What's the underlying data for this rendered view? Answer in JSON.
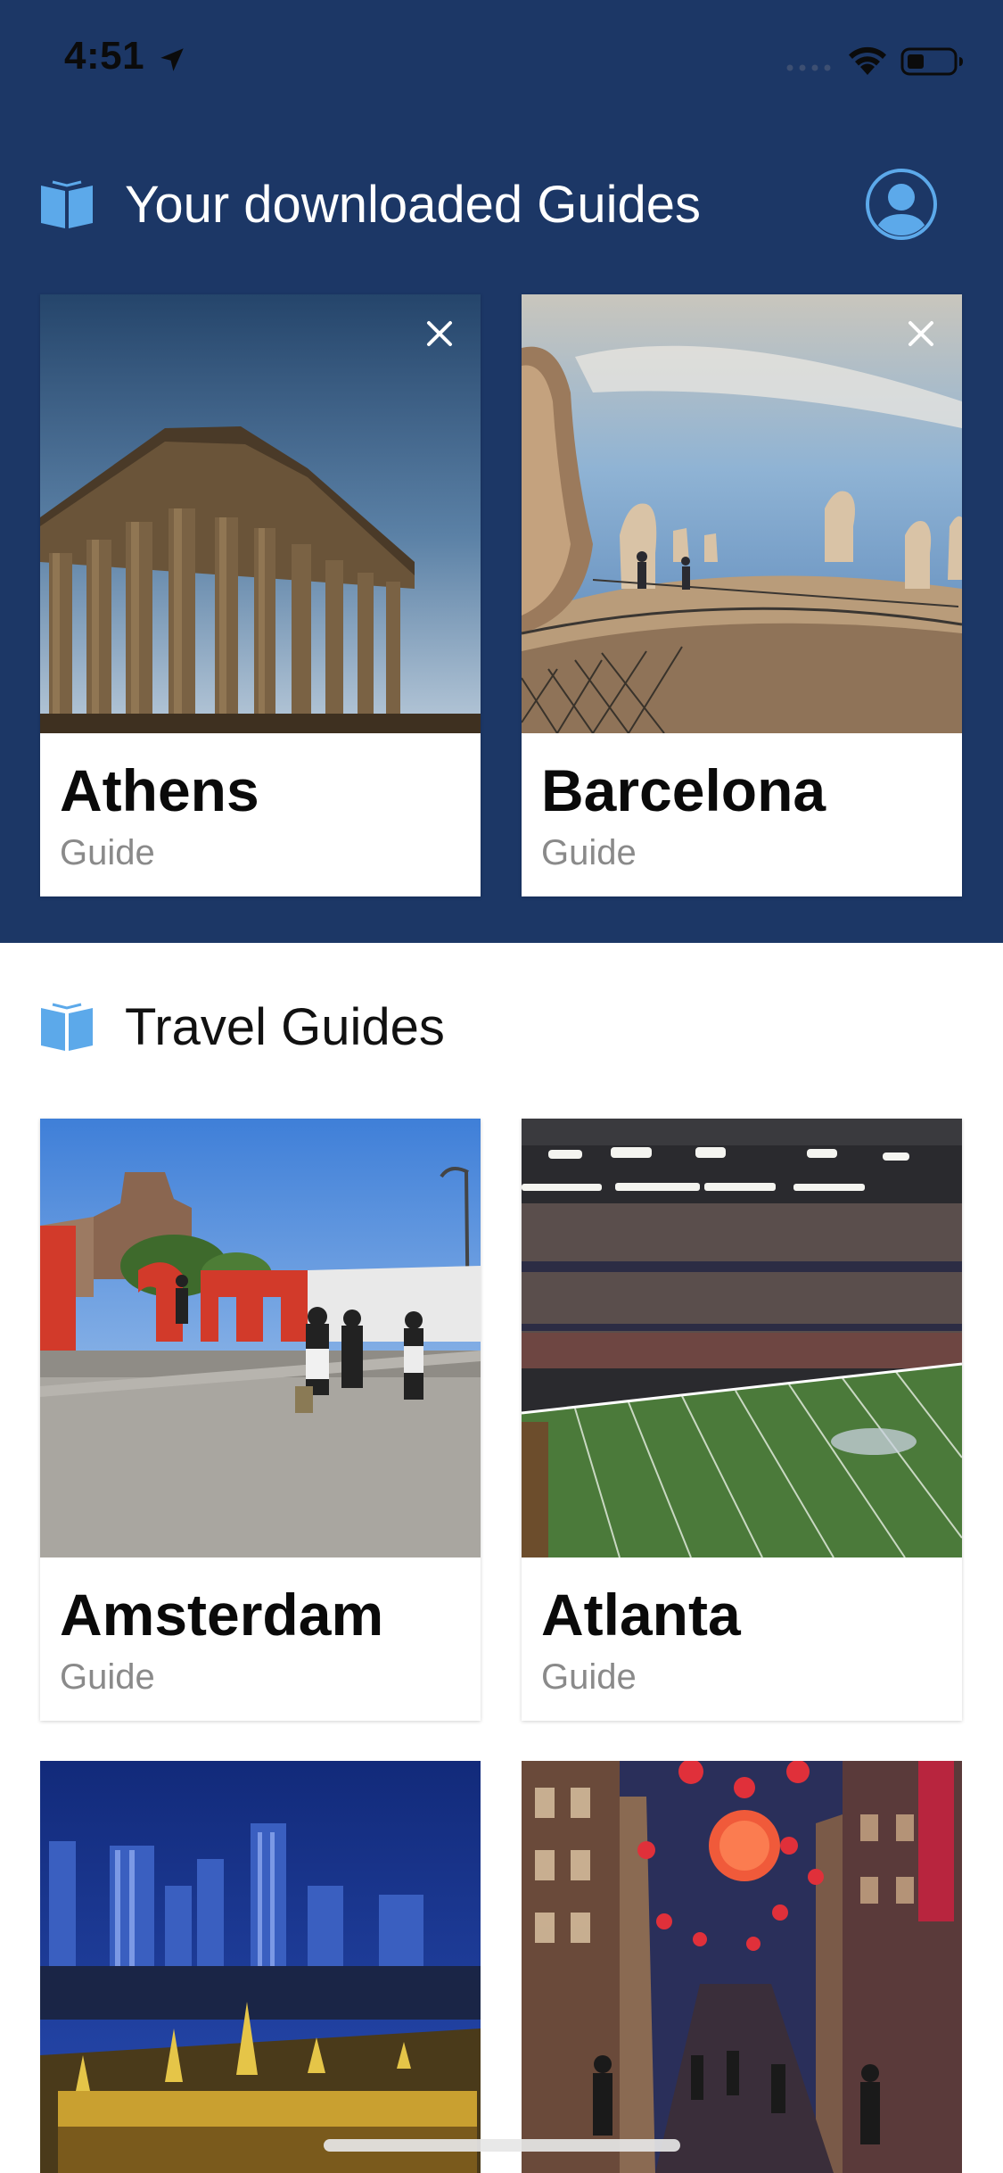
{
  "status_bar": {
    "time": "4:51"
  },
  "downloaded": {
    "title": "Your downloaded Guides",
    "icon": "book-icon",
    "profile_icon": "profile-icon",
    "guides": [
      {
        "city": "Athens",
        "label": "Guide"
      },
      {
        "city": "Barcelona",
        "label": "Guide"
      }
    ]
  },
  "travel": {
    "title": "Travel Guides",
    "icon": "book-icon",
    "guides": [
      {
        "city": "Amsterdam",
        "label": "Guide"
      },
      {
        "city": "Atlanta",
        "label": "Guide"
      },
      {
        "city": "",
        "label": ""
      },
      {
        "city": "",
        "label": ""
      }
    ]
  },
  "colors": {
    "header_bg": "#1c3766",
    "accent": "#5ca9ea",
    "card_bg": "#ffffff",
    "guide_label": "#8a8a8a"
  }
}
